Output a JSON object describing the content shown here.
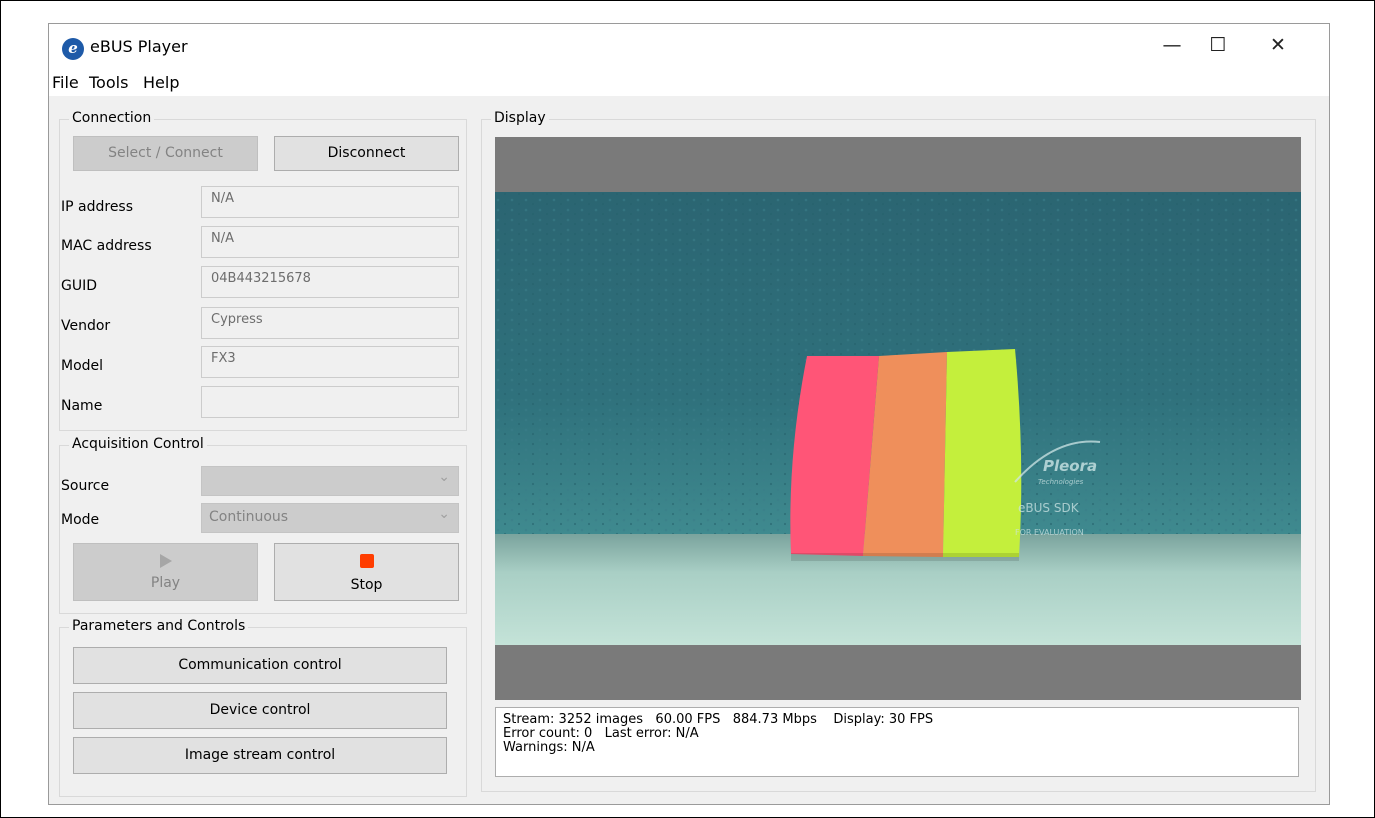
{
  "window": {
    "title": "eBUS Player",
    "icon": "ebus-e-icon",
    "controls": {
      "minimize": "—",
      "maximize": "☐",
      "close": "✕"
    }
  },
  "menu": [
    "File",
    "Tools",
    "Help"
  ],
  "connection": {
    "title": "Connection",
    "select_connect": "Select / Connect",
    "disconnect": "Disconnect",
    "fields": [
      {
        "label": "IP address",
        "value": "N/A"
      },
      {
        "label": "MAC address",
        "value": "N/A"
      },
      {
        "label": "GUID",
        "value": "04B443215678"
      },
      {
        "label": "Vendor",
        "value": "Cypress"
      },
      {
        "label": "Model",
        "value": "FX3"
      },
      {
        "label": "Name",
        "value": ""
      }
    ]
  },
  "acquisition": {
    "title": "Acquisition Control",
    "source_label": "Source",
    "source_value": "",
    "mode_label": "Mode",
    "mode_value": "Continuous",
    "play": "Play",
    "stop": "Stop"
  },
  "parameters": {
    "title": "Parameters and Controls",
    "buttons": [
      "Communication control",
      "Device control",
      "Image stream control"
    ]
  },
  "display": {
    "title": "Display",
    "watermark": {
      "brand": "Pleora",
      "sub": "Technologies",
      "sdk": "eBUS SDK",
      "note": "FOR EVALUATION"
    },
    "status": [
      "Stream: 3252 images   60.00 FPS   884.73 Mbps    Display: 30 FPS",
      "Error count: 0   Last error: N/A",
      "Warnings: N/A"
    ]
  },
  "colors": {
    "accent_icon": "#1e5aa8",
    "stop_red": "#ff3d00",
    "sticky_pink": "#ff5577",
    "sticky_orange": "#ef8f5b",
    "sticky_lime": "#c4ef3c",
    "wall_teal": "#2e6f7a"
  }
}
